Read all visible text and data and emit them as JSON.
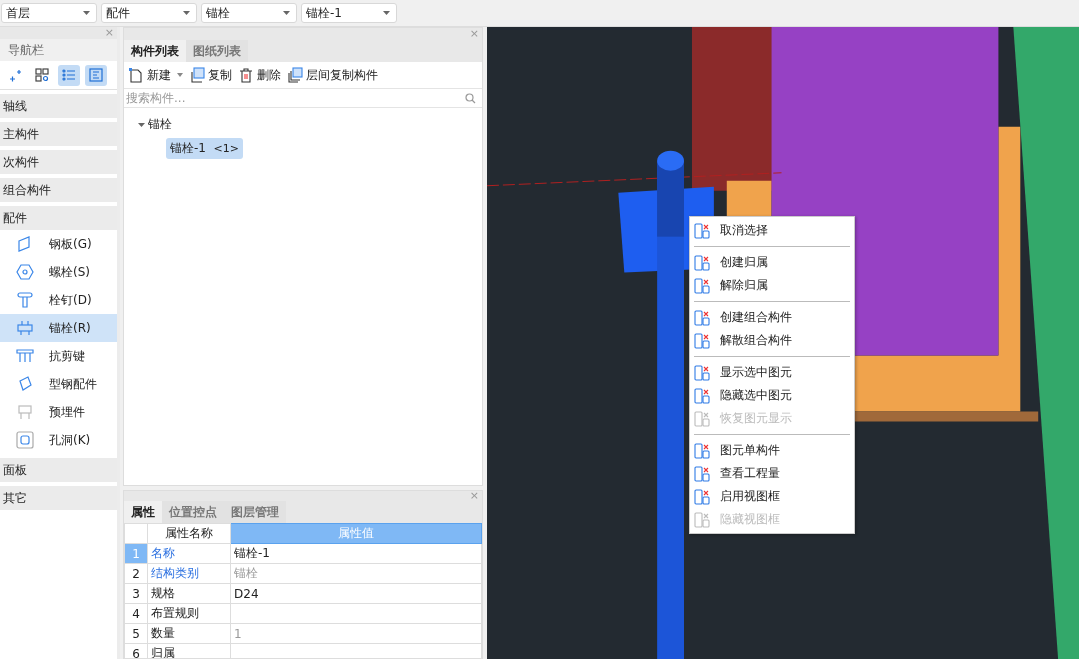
{
  "top_bar": {
    "dropdowns": [
      {
        "value": "首层"
      },
      {
        "value": "配件"
      },
      {
        "value": "锚栓"
      },
      {
        "value": "锚栓-1"
      }
    ]
  },
  "navigator": {
    "title": "导航栏",
    "close": "×",
    "tools": [
      {
        "selected": false
      },
      {
        "selected": false
      },
      {
        "selected": true
      },
      {
        "selected": true
      }
    ],
    "categories": [
      {
        "label": "轴线"
      },
      {
        "label": "主构件"
      },
      {
        "label": "次构件"
      },
      {
        "label": "组合构件"
      },
      {
        "label": "配件",
        "children": [
          {
            "label": "钢板(G)",
            "selected": false
          },
          {
            "label": "螺栓(S)",
            "selected": false
          },
          {
            "label": "栓钉(D)",
            "selected": false
          },
          {
            "label": "锚栓(R)",
            "selected": true
          },
          {
            "label": "抗剪键",
            "selected": false
          },
          {
            "label": "型钢配件",
            "selected": false
          },
          {
            "label": "预埋件",
            "selected": false
          },
          {
            "label": "孔洞(K)",
            "selected": false
          }
        ]
      },
      {
        "label": "面板"
      },
      {
        "label": "其它"
      }
    ]
  },
  "component_panel": {
    "close": "×",
    "tabs": [
      {
        "label": "构件列表",
        "selected": true
      },
      {
        "label": "图纸列表",
        "selected": false
      }
    ],
    "toolbar": [
      {
        "label": "新建",
        "has_menu": true
      },
      {
        "label": "复制",
        "has_menu": false
      },
      {
        "label": "删除",
        "has_menu": false
      },
      {
        "label": "层间复制构件",
        "has_menu": false
      }
    ],
    "search": {
      "placeholder": "搜索构件..."
    },
    "tree": [
      {
        "label": "锚栓",
        "expanded": true,
        "children": [
          {
            "label": "锚栓-1",
            "count": "<1>",
            "selected": true
          }
        ]
      }
    ]
  },
  "properties_panel": {
    "close": "×",
    "tabs": [
      {
        "label": "属性",
        "selected": true
      },
      {
        "label": "位置控点",
        "selected": false
      },
      {
        "label": "图层管理",
        "selected": false
      }
    ],
    "columns": [
      "属性名称",
      "属性值"
    ],
    "rows": [
      {
        "index": "1",
        "name": "名称",
        "value": "锚栓-1",
        "linked": true,
        "muted": false,
        "selected": true
      },
      {
        "index": "2",
        "name": "结构类别",
        "value": "锚栓",
        "linked": true,
        "muted": true,
        "selected": false
      },
      {
        "index": "3",
        "name": "规格",
        "value": "D24",
        "linked": false,
        "muted": false,
        "selected": false
      },
      {
        "index": "4",
        "name": "布置规则",
        "linked": false,
        "selected": false
      },
      {
        "index": "5",
        "name": "数量",
        "value": "1",
        "linked": false,
        "muted": true,
        "selected": false
      },
      {
        "index": "6",
        "name": "归属",
        "linked": false,
        "selected": false
      }
    ]
  },
  "context_menu": {
    "groups": [
      [
        {
          "label": "取消选择",
          "disabled": false
        }
      ],
      [
        {
          "label": "创建归属",
          "disabled": false
        },
        {
          "label": "解除归属",
          "disabled": false
        }
      ],
      [
        {
          "label": "创建组合构件",
          "disabled": false
        },
        {
          "label": "解散组合构件",
          "disabled": false
        }
      ],
      [
        {
          "label": "显示选中图元",
          "disabled": false
        },
        {
          "label": "隐藏选中图元",
          "disabled": false
        },
        {
          "label": "恢复图元显示",
          "disabled": true
        }
      ],
      [
        {
          "label": "图元单构件",
          "disabled": false
        },
        {
          "label": "查看工程量",
          "disabled": false
        },
        {
          "label": "启用视图框",
          "disabled": false
        },
        {
          "label": "隐藏视图框",
          "disabled": true
        }
      ]
    ]
  }
}
